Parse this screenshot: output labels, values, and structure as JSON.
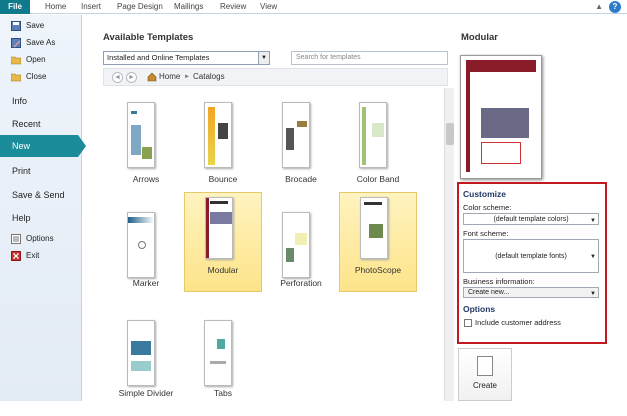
{
  "ribbon": {
    "file_tab": "File",
    "tabs": [
      "Home",
      "Insert",
      "Page Design",
      "Mailings",
      "Review",
      "View"
    ],
    "help": "?"
  },
  "nav": {
    "save": "Save",
    "save_as": "Save As",
    "open": "Open",
    "close": "Close",
    "info": "Info",
    "recent": "Recent",
    "new": "New",
    "print": "Print",
    "save_send": "Save & Send",
    "help": "Help",
    "options": "Options",
    "exit": "Exit"
  },
  "main": {
    "title": "Available Templates",
    "source_select": "Installed and Online Templates",
    "search_placeholder": "Search for templates",
    "breadcrumb_home": "Home",
    "breadcrumb_sep": "►",
    "breadcrumb_current": "Catalogs"
  },
  "templates": [
    {
      "name": "Arrows",
      "selected": false
    },
    {
      "name": "Bounce",
      "selected": false
    },
    {
      "name": "Brocade",
      "selected": false
    },
    {
      "name": "Color Band",
      "selected": false
    },
    {
      "name": "Marker",
      "selected": false
    },
    {
      "name": "Modular",
      "selected": true
    },
    {
      "name": "Perforation",
      "selected": false
    },
    {
      "name": "PhotoScope",
      "selected": true
    },
    {
      "name": "Simple Divider",
      "selected": false
    },
    {
      "name": "Tabs",
      "selected": false
    }
  ],
  "right": {
    "title": "Modular",
    "customize": "Customize",
    "color_scheme_label": "Color scheme:",
    "color_scheme_value": "(default template colors)",
    "font_scheme_label": "Font scheme:",
    "font_scheme_value": "(default template fonts)",
    "business_info_label": "Business information:",
    "business_info_value": "Create new...",
    "options": "Options",
    "include_customer_address": "Include customer address",
    "create": "Create"
  },
  "colors": {
    "file_tab": "#0f7a8c",
    "nav_active": "#1a8c9a",
    "customize_border": "#c0191f",
    "selected_tile": "#fde48a"
  }
}
